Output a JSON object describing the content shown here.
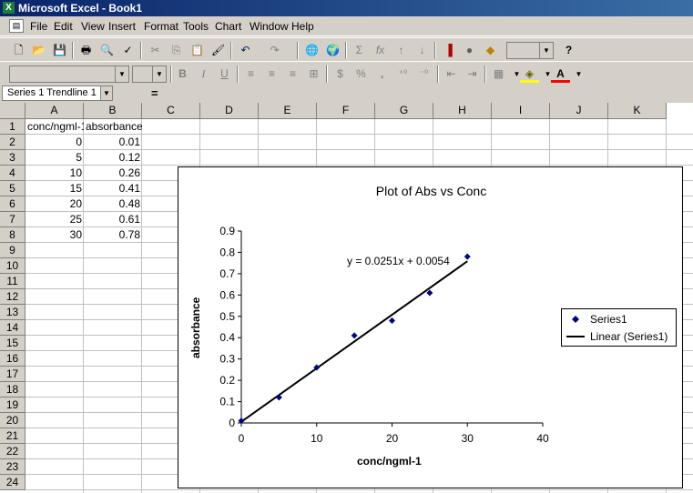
{
  "window": {
    "title": "Microsoft Excel - Book1"
  },
  "menu": [
    "File",
    "Edit",
    "View",
    "Insert",
    "Format",
    "Tools",
    "Chart",
    "Window",
    "Help"
  ],
  "toolbar1": {
    "buttons": [
      {
        "name": "new-icon",
        "glyph": "🗋"
      },
      {
        "name": "open-icon",
        "glyph": "📂"
      },
      {
        "name": "save-icon",
        "glyph": "💾"
      },
      {
        "name": "print-icon",
        "glyph": "🖶"
      },
      {
        "name": "print-preview-icon",
        "glyph": "🔍"
      },
      {
        "name": "spelling-icon",
        "glyph": "✓"
      },
      {
        "name": "cut-icon",
        "glyph": "✂"
      },
      {
        "name": "copy-icon",
        "glyph": "⎘"
      },
      {
        "name": "paste-icon",
        "glyph": "📋"
      },
      {
        "name": "format-painter-icon",
        "glyph": "🖌"
      },
      {
        "name": "undo-icon",
        "glyph": "↶"
      },
      {
        "name": "redo-icon",
        "glyph": "↷"
      },
      {
        "name": "insert-hyperlink-icon",
        "glyph": "🌐"
      },
      {
        "name": "web-toolbar-icon",
        "glyph": "🌍"
      },
      {
        "name": "autosum-icon",
        "glyph": "Σ"
      },
      {
        "name": "paste-function-icon",
        "glyph": "fx"
      },
      {
        "name": "sort-ascending-icon",
        "glyph": "↑"
      },
      {
        "name": "sort-descending-icon",
        "glyph": "↓"
      },
      {
        "name": "chart-wizard-icon",
        "glyph": "▐"
      },
      {
        "name": "map-icon",
        "glyph": "●"
      },
      {
        "name": "drawing-icon",
        "glyph": "◆"
      },
      {
        "name": "help-icon",
        "glyph": "?"
      }
    ]
  },
  "toolbar2": {
    "buttons": [
      {
        "name": "bold-icon",
        "glyph": "B"
      },
      {
        "name": "italic-icon",
        "glyph": "I"
      },
      {
        "name": "underline-icon",
        "glyph": "U"
      },
      {
        "name": "align-left-icon",
        "glyph": "≡"
      },
      {
        "name": "align-center-icon",
        "glyph": "≡"
      },
      {
        "name": "align-right-icon",
        "glyph": "≡"
      },
      {
        "name": "merge-center-icon",
        "glyph": "⊞"
      },
      {
        "name": "currency-icon",
        "glyph": "$"
      },
      {
        "name": "percent-icon",
        "glyph": "%"
      },
      {
        "name": "comma-icon",
        "glyph": ","
      },
      {
        "name": "increase-decimal-icon",
        "glyph": "⁺⁰"
      },
      {
        "name": "decrease-decimal-icon",
        "glyph": "⁻⁰"
      },
      {
        "name": "decrease-indent-icon",
        "glyph": "⇤"
      },
      {
        "name": "increase-indent-icon",
        "glyph": "⇥"
      },
      {
        "name": "borders-icon",
        "glyph": "▦"
      },
      {
        "name": "fill-color-icon",
        "glyph": "◈"
      },
      {
        "name": "font-color-icon",
        "glyph": "A"
      }
    ]
  },
  "formula_bar": {
    "name_box": "Series 1 Trendline 1",
    "equals": "=",
    "formula": ""
  },
  "columns": [
    "A",
    "B",
    "C",
    "D",
    "E",
    "F",
    "G",
    "H",
    "I",
    "J",
    "K"
  ],
  "rows": [
    "1",
    "2",
    "3",
    "4",
    "5",
    "6",
    "7",
    "8",
    "9",
    "10",
    "11",
    "12",
    "13",
    "14",
    "15",
    "16",
    "17",
    "18",
    "19",
    "20",
    "21",
    "22",
    "23",
    "24"
  ],
  "cells": {
    "A1": "conc/ngml-1",
    "B1": "absorbance",
    "A2": "0",
    "B2": "0.01",
    "A3": "5",
    "B3": "0.12",
    "A4": "10",
    "B4": "0.26",
    "A5": "15",
    "B5": "0.41",
    "A6": "20",
    "B6": "0.48",
    "A7": "25",
    "B7": "0.61",
    "A8": "30",
    "B8": "0.78"
  },
  "chart_data": {
    "type": "scatter",
    "title": "Plot of Abs vs Conc",
    "xlabel": "conc/ngml-1",
    "ylabel": "absorbance",
    "xlim": [
      0,
      40
    ],
    "ylim": [
      0,
      0.9
    ],
    "xticks": [
      "0",
      "10",
      "20",
      "30",
      "40"
    ],
    "yticks": [
      "0",
      "0.1",
      "0.2",
      "0.3",
      "0.4",
      "0.5",
      "0.6",
      "0.7",
      "0.8",
      "0.9"
    ],
    "series": [
      {
        "name": "Series1",
        "x": [
          0,
          5,
          10,
          15,
          20,
          25,
          30
        ],
        "y": [
          0.01,
          0.12,
          0.26,
          0.41,
          0.48,
          0.61,
          0.78
        ]
      }
    ],
    "trendline": {
      "name": "Linear (Series1)",
      "slope": 0.0251,
      "intercept": 0.0054,
      "equation": "y = 0.0251x + 0.0054"
    },
    "grid": false,
    "legend_position": "right",
    "colors": {
      "marker": "#000080",
      "trendline": "#000000"
    }
  }
}
